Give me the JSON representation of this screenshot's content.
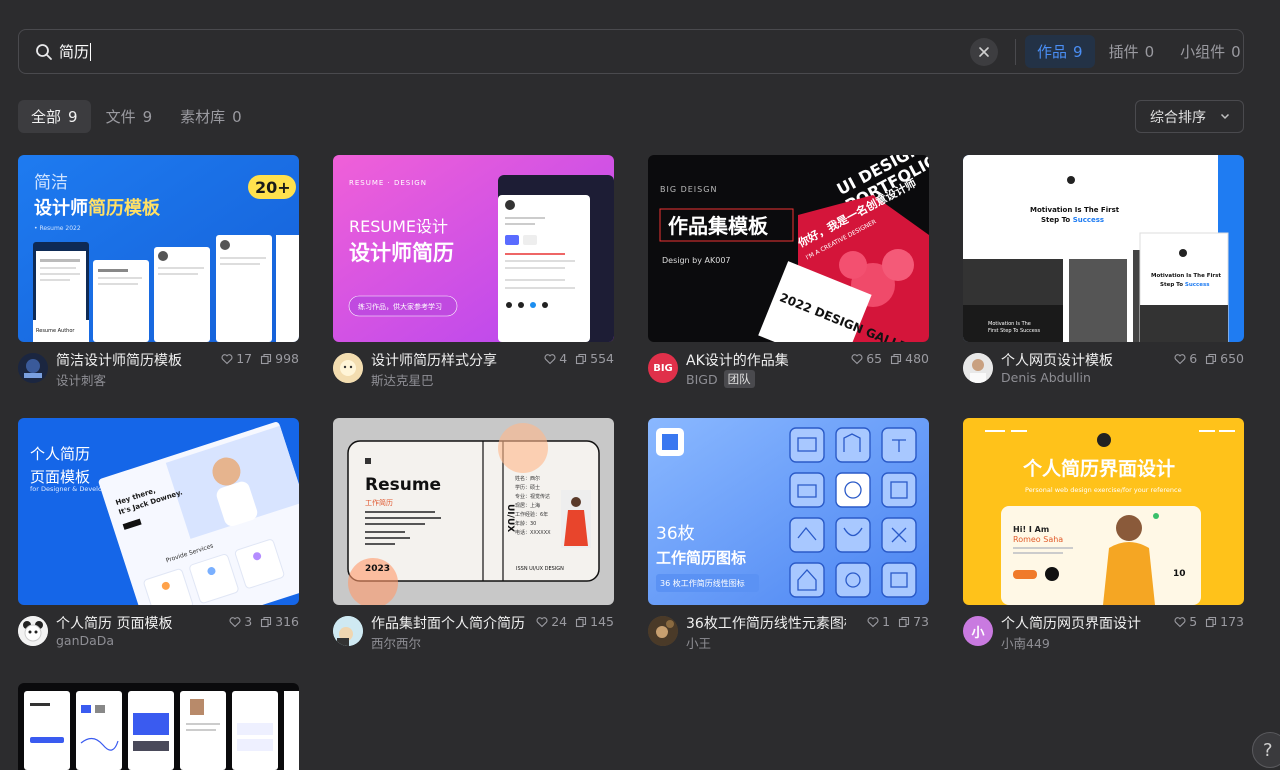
{
  "search": {
    "query": "简历"
  },
  "search_tabs": [
    {
      "label": "作品",
      "count": "9"
    },
    {
      "label": "插件",
      "count": "0"
    },
    {
      "label": "小组件",
      "count": "0"
    }
  ],
  "filter_tabs": [
    {
      "label": "全部",
      "count": "9"
    },
    {
      "label": "文件",
      "count": "9"
    },
    {
      "label": "素材库",
      "count": "0"
    }
  ],
  "sort": {
    "label": "综合排序"
  },
  "cards": [
    {
      "title": "简洁设计师简历模板",
      "author": "设计刺客",
      "likes": "17",
      "copies": "998",
      "thumb": {
        "l1": "简洁",
        "l2a": "设计师",
        "l2b": "简历模板",
        "badge": "20+",
        "sub": "• Resume 2022",
        "name": "Resume Author"
      }
    },
    {
      "title": "设计师简历样式分享",
      "author": "斯达克星巴",
      "likes": "4",
      "copies": "554",
      "thumb": {
        "l0": "RESUME · DESIGN",
        "l1": "RESUME设计",
        "l2": "设计师简历",
        "btn": "练习作品，供大家参考学习"
      }
    },
    {
      "title": "AK设计的作品集",
      "author": "BIGD",
      "team": "团队",
      "likes": "65",
      "copies": "480",
      "thumb": {
        "l0": "BIG DEISGN",
        "l1": "作品集模板",
        "l2": "Design by AK007",
        "r1": "UI DESIGN",
        "r2": "PORTFOLIO",
        "r3": "2022 DESIGN GALLERY",
        "r4": "你好，我是一名创意设计师",
        "r5": "I'M A CREATIVE DESIGNER",
        "avatar": "BIG"
      }
    },
    {
      "title": "个人网页设计模板",
      "author": "Denis Abdullin",
      "likes": "6",
      "copies": "650",
      "thumb": {
        "h1": "Motivation Is The First",
        "h2a": "Step To ",
        "h2b": "Success",
        "p1": "Motivation Is The",
        "p2": "First Step To Success",
        "m1": "Motivation Is The First",
        "m2a": "Step To ",
        "m2b": "Success"
      }
    },
    {
      "title": "个人简历 页面模板",
      "author": "ganDaDa",
      "likes": "3",
      "copies": "316",
      "thumb": {
        "l1": "个人简历",
        "l2": "页面模板",
        "l3": "for Designer & Developer",
        "hey": "Hey there,",
        "jack": "It's Jack Downey.",
        "sv": "Provide Services"
      }
    },
    {
      "title": "作品集封面个人简介简历",
      "author": "西尔西尔",
      "likes": "24",
      "copies": "145",
      "thumb": {
        "l1": "Resume",
        "l2": "工作简历",
        "year": "2023",
        "side": "UI/UX",
        "foot": "ISSN    UI/UX    DESIGN",
        "info": [
          "姓名：西尔",
          "学历：硕士",
          "专业：视觉传达",
          "现居：上海",
          "工作经验：6年",
          "年龄：30",
          "电话：XXXXXX"
        ]
      }
    },
    {
      "title": "36枚工作简历线性元素图标",
      "author": "小王",
      "likes": "1",
      "copies": "73",
      "thumb": {
        "l1": "36枚",
        "l2": "工作简历图标",
        "l3": "36 枚工作简历线性图标"
      }
    },
    {
      "title": "个人简历网页界面设计",
      "author": "小南449",
      "likes": "5",
      "copies": "173",
      "thumb": {
        "l1": "个人简历界面设计",
        "l2": "Personal web design exercise/for your reference",
        "hi": "Hi! I Am",
        "nm": "Romeo Saha",
        "n": "10"
      }
    }
  ],
  "colors": {
    "accent": "#4a8ef4",
    "bg": "#2c2c2e"
  }
}
